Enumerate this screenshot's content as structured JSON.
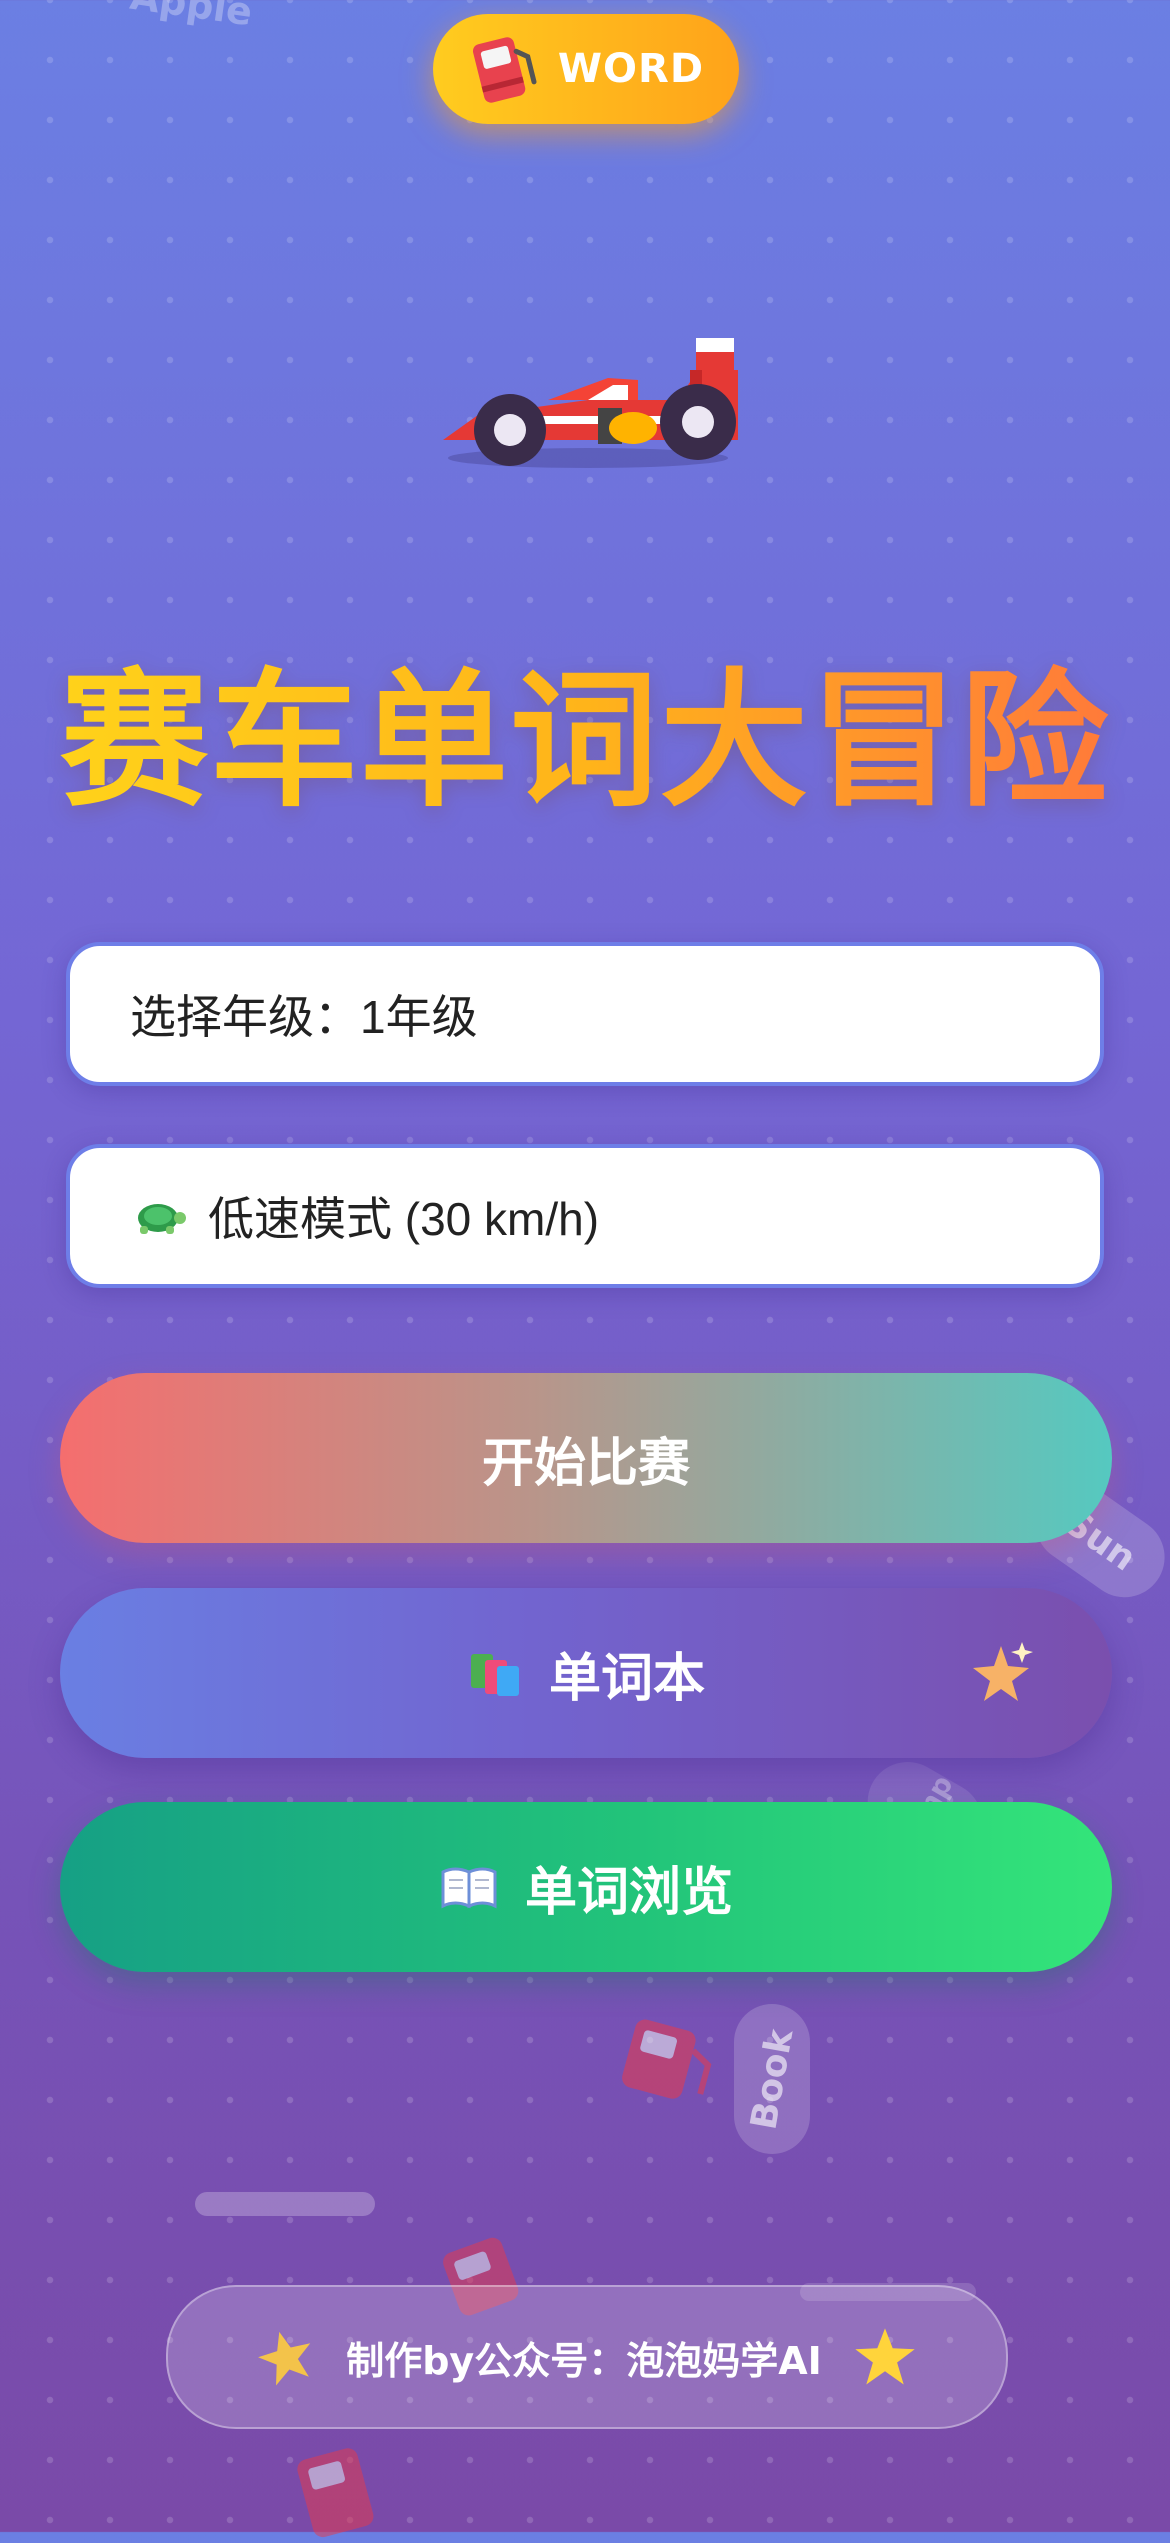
{
  "badge": {
    "label": "WORD",
    "icon": "fuel-pump-icon"
  },
  "hero": {
    "icon": "race-car-icon",
    "title": "赛车单词大冒险"
  },
  "grade_select": {
    "value": "选择年级：1年级"
  },
  "speed_select": {
    "icon": "turtle-icon",
    "value": "低速模式 (30 km/h)"
  },
  "buttons": {
    "start": {
      "label": "开始比赛"
    },
    "wordbook": {
      "label": "单词本",
      "icon": "books-icon",
      "decor_icon": "sparkle-star-icon"
    },
    "browse": {
      "label": "单词浏览",
      "icon": "open-book-icon"
    }
  },
  "background_words": [
    "Apple",
    "Sun",
    "Jump",
    "Book"
  ],
  "footer": {
    "text": "制作by公众号：泡泡妈学AI",
    "left_icon": "star-icon",
    "right_icon": "star-icon"
  },
  "colors": {
    "title_gradient": [
      "#ffd21a",
      "#ff7a3a"
    ],
    "badge": "#ffb41a",
    "start_gradient": [
      "#f56e6e",
      "#55c9c0"
    ],
    "browse_gradient": [
      "#16a085",
      "#34e57a"
    ]
  }
}
